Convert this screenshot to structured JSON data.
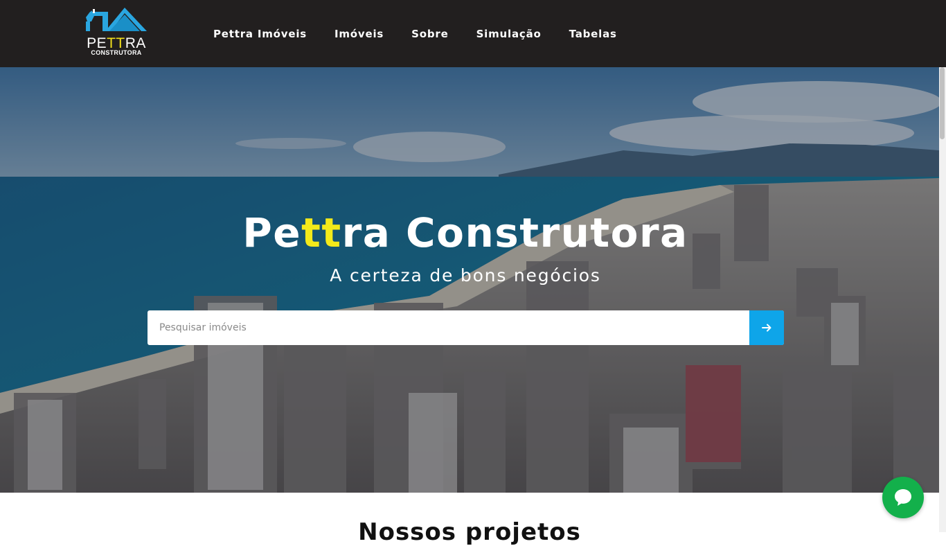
{
  "brand": {
    "logo_prefix": "PE",
    "logo_highlight": "TT",
    "logo_suffix": "RA",
    "logo_sub": "CONSTRUTORA"
  },
  "nav": {
    "items": [
      {
        "label": "Pettra Imóveis"
      },
      {
        "label": "Imóveis"
      },
      {
        "label": "Sobre"
      },
      {
        "label": "Simulação"
      },
      {
        "label": "Tabelas"
      }
    ]
  },
  "hero": {
    "title_prefix": "Pe",
    "title_highlight": "tt",
    "title_suffix": "ra Construtora",
    "subtitle": "A certeza de bons negócios",
    "search_placeholder": "Pesquisar imóveis",
    "search_icon": "arrow-right-icon"
  },
  "section": {
    "heading": "Nossos projetos"
  },
  "chat": {
    "icon": "chat-bubble-icon"
  },
  "colors": {
    "navbar": "#221f1f",
    "accent_yellow": "#f4ea1a",
    "search_button": "#0ea5e9",
    "chat_button": "#13b04b",
    "logo_roof": "#2aa6e0"
  }
}
